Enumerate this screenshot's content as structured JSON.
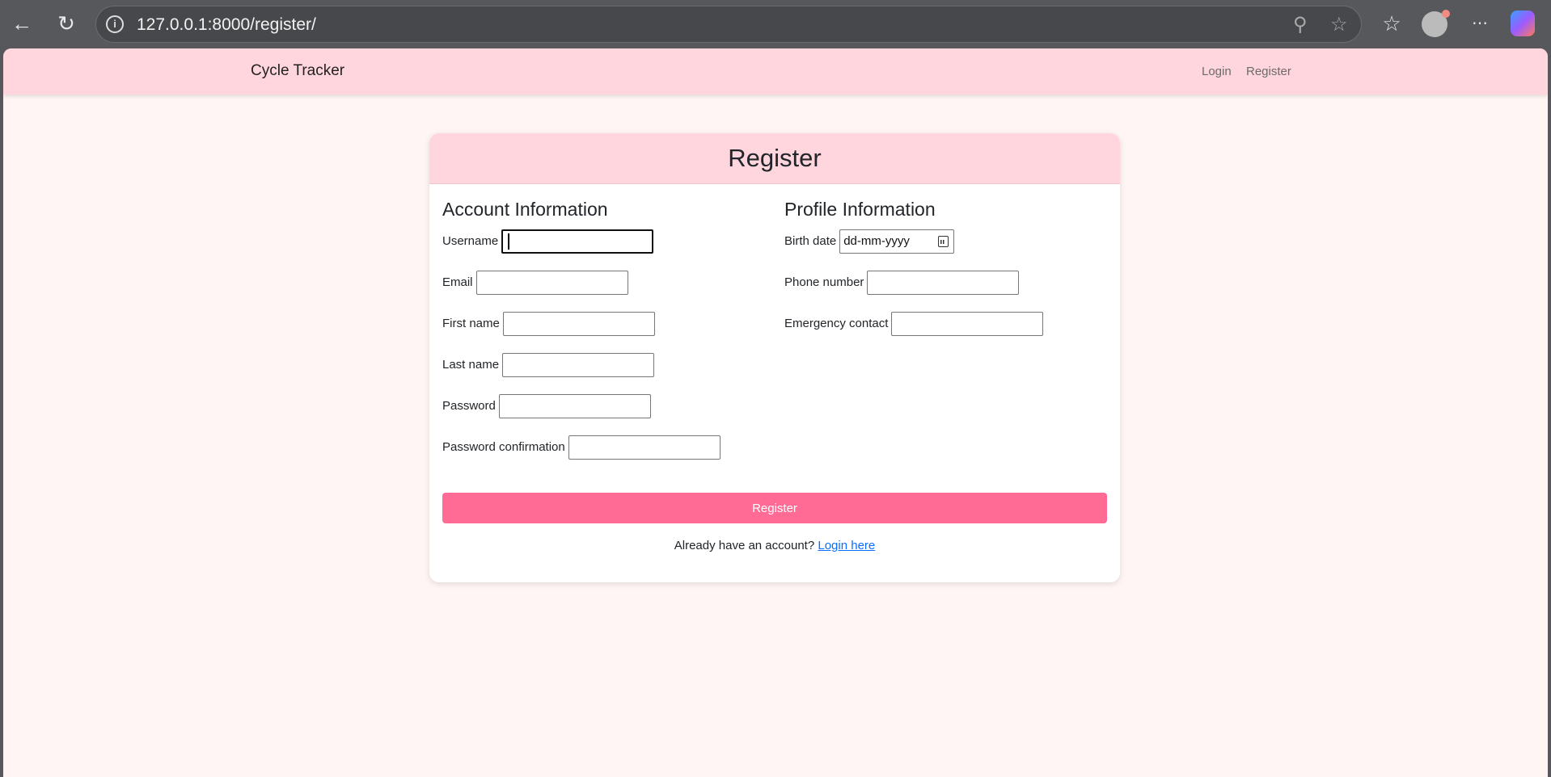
{
  "browser": {
    "url": "127.0.0.1:8000/register/"
  },
  "navbar": {
    "brand": "Cycle Tracker",
    "links": [
      {
        "label": "Login"
      },
      {
        "label": "Register"
      }
    ]
  },
  "card": {
    "title": "Register",
    "account": {
      "heading": "Account Information",
      "fields": [
        {
          "label": "Username",
          "value": ""
        },
        {
          "label": "Email",
          "value": ""
        },
        {
          "label": "First name",
          "value": ""
        },
        {
          "label": "Last name",
          "value": ""
        },
        {
          "label": "Password",
          "value": ""
        },
        {
          "label": "Password confirmation",
          "value": ""
        }
      ]
    },
    "profile": {
      "heading": "Profile Information",
      "birth_date": {
        "label": "Birth date",
        "placeholder": "dd-mm-yyyy"
      },
      "fields": [
        {
          "label": "Phone number",
          "value": ""
        },
        {
          "label": "Emergency contact",
          "value": ""
        }
      ]
    },
    "submit_label": "Register",
    "footer_text": "Already have an account?",
    "footer_link": "Login here"
  },
  "colors": {
    "accent": "#ff6b94",
    "header": "#ffd6de",
    "background": "#fff5f5",
    "link": "#0d6efd"
  }
}
